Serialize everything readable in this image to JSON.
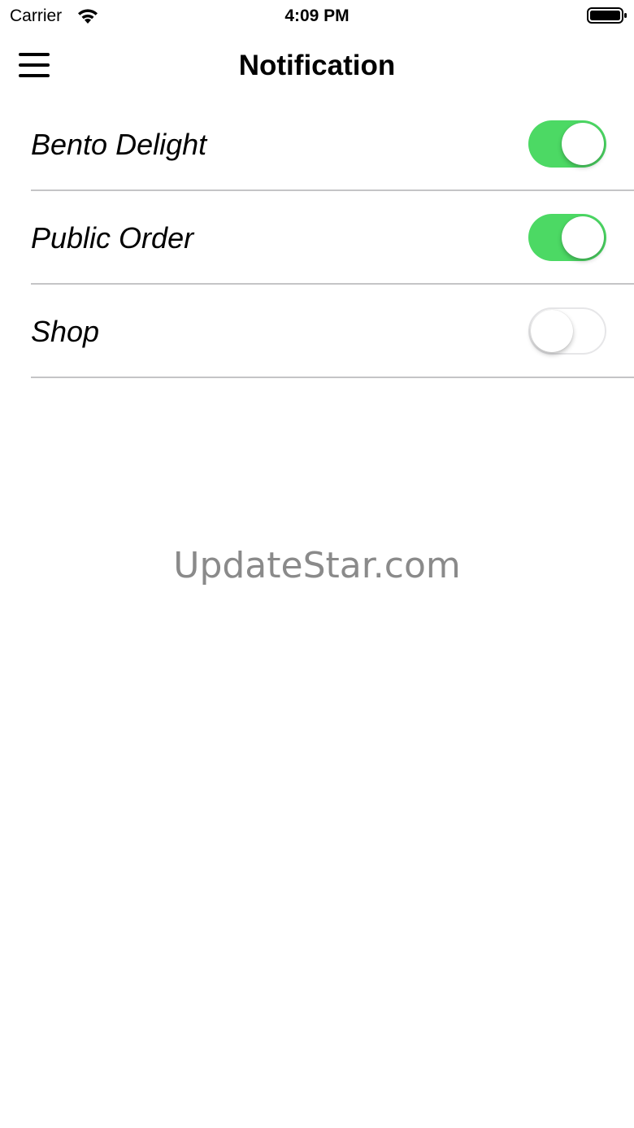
{
  "status_bar": {
    "carrier": "Carrier",
    "time": "4:09 PM",
    "wifi_icon": "wifi-icon",
    "battery_icon": "battery-icon"
  },
  "nav": {
    "menu_icon": "hamburger-menu-icon",
    "title": "Notification"
  },
  "settings": [
    {
      "label": "Bento Delight",
      "enabled": true
    },
    {
      "label": "Public Order",
      "enabled": true
    },
    {
      "label": "Shop",
      "enabled": false
    }
  ],
  "watermark": "UpdateStar.com",
  "colors": {
    "toggle_on": "#4cd964",
    "toggle_off_border": "#e6e6e8",
    "divider": "#c4c4c6",
    "watermark": "#8a8a8a"
  }
}
